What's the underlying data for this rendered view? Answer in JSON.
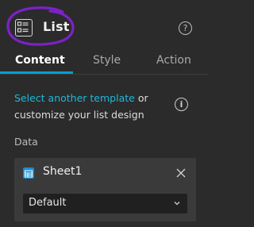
{
  "header": {
    "widget_icon": "list-widget-icon",
    "title": "List",
    "help_icon": "question-circle-icon",
    "help_glyph": "?"
  },
  "tabs": [
    {
      "label": "Content",
      "active": true
    },
    {
      "label": "Style",
      "active": false
    },
    {
      "label": "Action",
      "active": false
    }
  ],
  "content": {
    "template_link": "Select another template",
    "template_text_1": "or",
    "template_text_2": "customize your list design",
    "info_icon": "info-circle-icon",
    "info_glyph": "i"
  },
  "data": {
    "label": "Data",
    "source": {
      "icon": "table-icon",
      "name": "Sheet1",
      "remove_icon": "close-icon"
    },
    "view_select": {
      "value": "Default",
      "icon": "chevron-down-icon"
    }
  },
  "colors": {
    "background": "#2b2b2b",
    "accent": "#00a0d2",
    "link": "#1fb8d9",
    "highlight_annotation": "#7b22c8",
    "datasource_icon": "#1a8fd6"
  }
}
